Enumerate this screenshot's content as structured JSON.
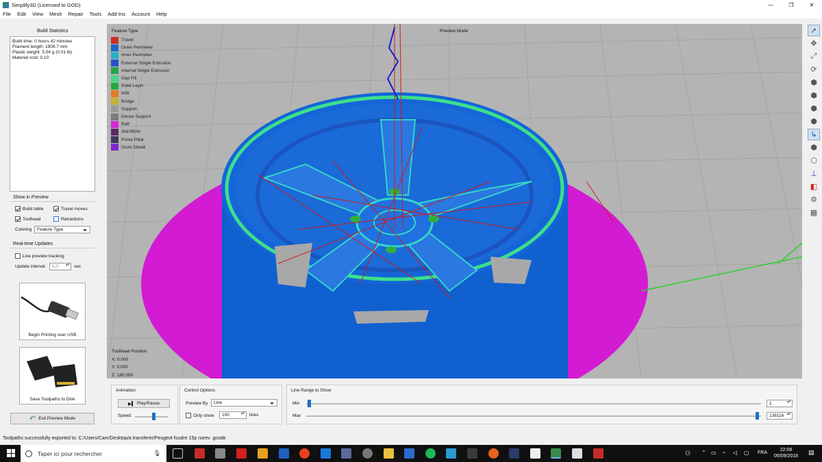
{
  "window": {
    "title": "Simplify3D (Licensed to GOD)",
    "minimize": "—",
    "maximize": "❐",
    "close": "✕"
  },
  "menu": [
    "File",
    "Edit",
    "View",
    "Mesh",
    "Repair",
    "Tools",
    "Add-Ins",
    "Account",
    "Help"
  ],
  "build_stats": {
    "header": "Build Statistics",
    "lines": [
      "Build time: 0 hours 42 minutes",
      "Filament length: 1906.7 mm",
      "Plastic weight: 5.54 g (0.01 lb)",
      "Material cost: 0.10"
    ]
  },
  "show_in_preview": {
    "header": "Show in Preview",
    "build_table": {
      "label": "Build table",
      "checked": true
    },
    "travel_moves": {
      "label": "Travel moves",
      "checked": true
    },
    "toolhead": {
      "label": "Toolhead",
      "checked": true
    },
    "retractions": {
      "label": "Retractions",
      "checked": false
    },
    "coloring_label": "Coloring",
    "coloring_value": "Feature Type"
  },
  "realtime": {
    "header": "Real-time Updates",
    "live_label": "Live preview tracking",
    "interval_label": "Update interval",
    "interval_value": "5,0",
    "interval_unit": "sec"
  },
  "usb_button": "Begin Printing over USB",
  "sd_button": "Save Toolpaths to Disk",
  "exit_button": "Exit Preview Mode",
  "viewport": {
    "legend_title": "Feature Type",
    "mode": "Preview Mode",
    "toolhead_title": "Toolhead Position",
    "x": "X: 0.000",
    "y": "Y: 0.000",
    "z": "Z: 180.000"
  },
  "legend": [
    {
      "label": "Travel",
      "color": "#c8302a"
    },
    {
      "label": "Outer Perimeter",
      "color": "#1e64c8"
    },
    {
      "label": "Inner Perimeter",
      "color": "#27b0c8"
    },
    {
      "label": "External Single Extrusion",
      "color": "#2a4fd0"
    },
    {
      "label": "Internal Single Extrusion",
      "color": "#28a44a"
    },
    {
      "label": "Gap Fill",
      "color": "#4bd68a"
    },
    {
      "label": "Solid Layer",
      "color": "#28a83a"
    },
    {
      "label": "Infill",
      "color": "#e07a2a"
    },
    {
      "label": "Bridge",
      "color": "#c8b030"
    },
    {
      "label": "Support",
      "color": "#9a9a9a"
    },
    {
      "label": "Dense Support",
      "color": "#7a7a7a"
    },
    {
      "label": "Raft",
      "color": "#d02ad0"
    },
    {
      "label": "Skirt/Brim",
      "color": "#5a2a6a"
    },
    {
      "label": "Prime Pillar",
      "color": "#3a3a5a"
    },
    {
      "label": "Ooze Shield",
      "color": "#7a2ad0"
    }
  ],
  "animation": {
    "header": "Animation",
    "play": "Play/Pause",
    "speed_label": "Speed:"
  },
  "control": {
    "header": "Control Options",
    "preview_by_label": "Preview By",
    "preview_by_value": "Line",
    "only_show_label": "Only show",
    "only_show_value": "100",
    "lines_label": "lines"
  },
  "line_range": {
    "header": "Line Range to Show",
    "min_label": "Min",
    "min_value": "1",
    "max_label": "Max",
    "max_value": "138116"
  },
  "status": "Toolpaths successfully exported to: C:/Users/Cam/Desktop/a transferer/Peugeot foudre 15p norev .gcode",
  "taskbar": {
    "search": "Taper ici pour rechercher",
    "lang": "FRA",
    "time": "22:08",
    "date": "05/09/2018"
  }
}
